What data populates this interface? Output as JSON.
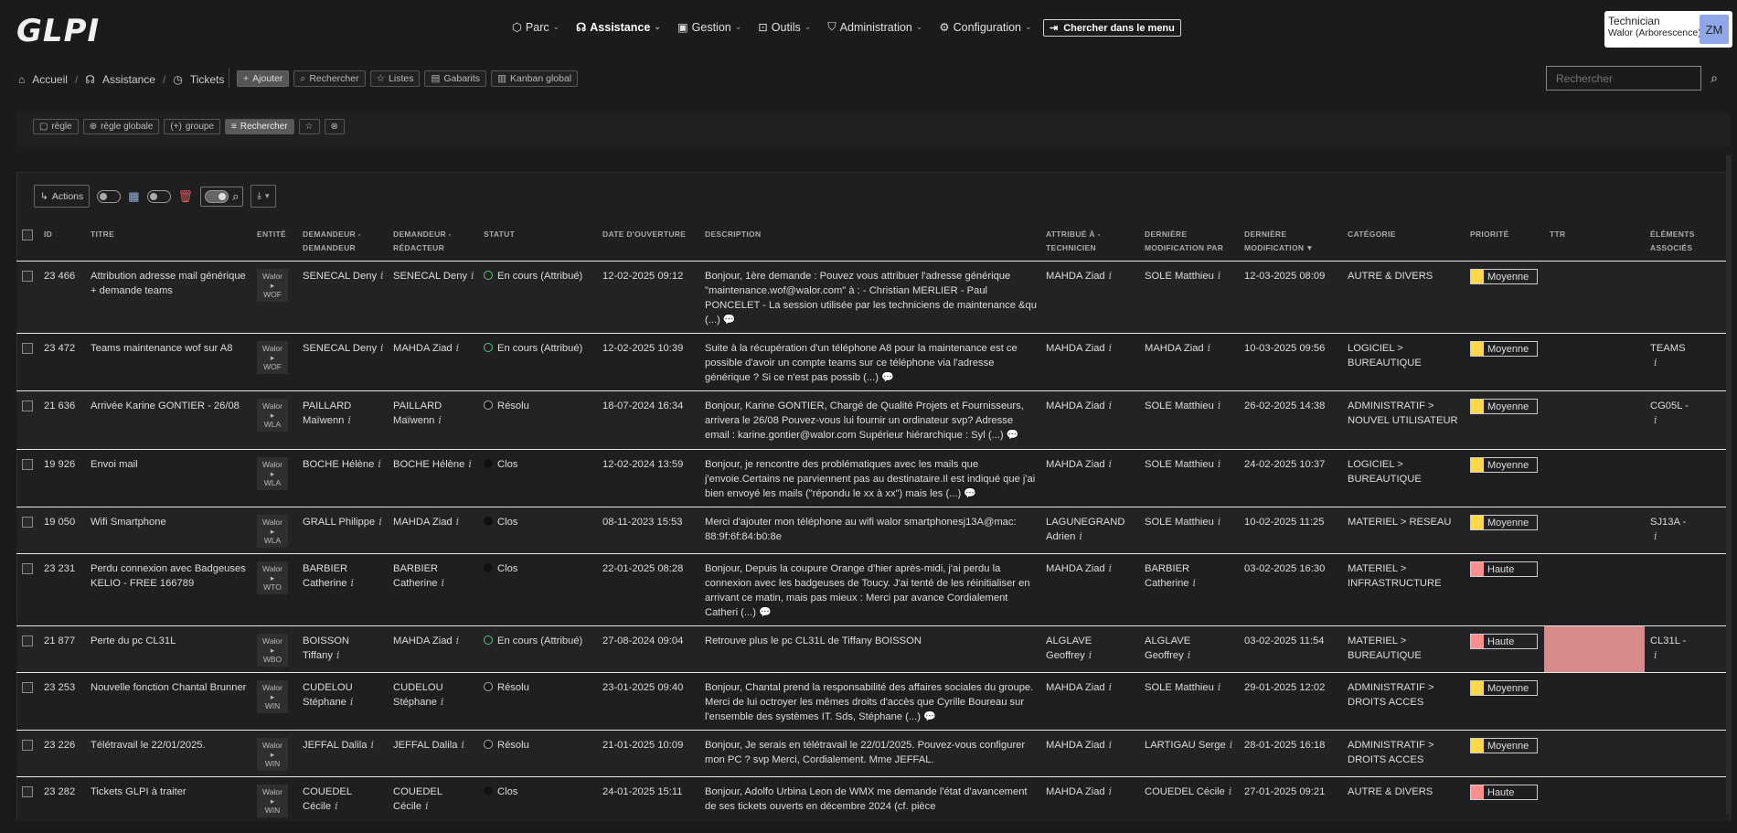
{
  "app": {
    "logo": "GLPI"
  },
  "menu": [
    {
      "icon": "box-icon",
      "glyph": "⬡",
      "label": "Parc"
    },
    {
      "icon": "headset-icon",
      "glyph": "☊",
      "label": "Assistance"
    },
    {
      "icon": "wallet-icon",
      "glyph": "▣",
      "label": "Gestion"
    },
    {
      "icon": "briefcase-icon",
      "glyph": "⊡",
      "label": "Outils"
    },
    {
      "icon": "shield-icon",
      "glyph": "⛉",
      "label": "Administration"
    },
    {
      "icon": "gear-icon",
      "glyph": "⚙",
      "label": "Configuration"
    }
  ],
  "menu_search": "Chercher dans le menu",
  "user": {
    "role": "Technician",
    "entity": "Walor (Arborescence)",
    "initials": "ZM"
  },
  "breadcrumb": [
    "Accueil",
    "Assistance",
    "Tickets"
  ],
  "actions": [
    "Ajouter",
    "Rechercher",
    "Listes",
    "Gabarits",
    "Kanban global"
  ],
  "search": {
    "placeholder": "Rechercher"
  },
  "criteria_buttons": [
    "règle",
    "règle globale",
    "groupe",
    "Rechercher"
  ],
  "toolbar": {
    "actions_label": "Actions"
  },
  "columns": [
    "",
    "ID",
    "TITRE",
    "ENTITÉ",
    "DEMANDEUR - DEMANDEUR",
    "DEMANDEUR - RÉDACTEUR",
    "STATUT",
    "DATE D'OUVERTURE",
    "DESCRIPTION",
    "ATTRIBUÉ À - TECHNICIEN",
    "DERNIÈRE MODIFICATION PAR",
    "DERNIÈRE MODIFICATION",
    "CATÉGORIE",
    "PRIORITÉ",
    "TTR",
    "ÉLÉMENTS ASSOCIÉS"
  ],
  "sort_indicator": "▼",
  "rows": [
    {
      "id": "23 466",
      "title": "Attribution adresse mail générique + demande teams",
      "entity_top": "Walor",
      "entity_bottom": "WOF",
      "requester": "SENECAL Deny",
      "writer": "SENECAL Deny",
      "status": "En cours (Attribué)",
      "status_kind": "cours",
      "opened": "12-02-2025 09:12",
      "description": "Bonjour, 1ère demande : Pouvez vous attribuer l'adresse générique \"maintenance.wof@walor.com\" à : - Christian MERLIER - Paul PONCELET - La session utilisée par les techniciens de maintenance &qu (...)",
      "tech": "MAHDA Ziad",
      "modified_by": "SOLE Matthieu",
      "modified": "12-03-2025 08:09",
      "category": "AUTRE & DIVERS",
      "priority": "Moyenne",
      "priority_kind": "moy",
      "ttr": "",
      "items": ""
    },
    {
      "id": "23 472",
      "title": "Teams maintenance wof sur A8",
      "entity_top": "Walor",
      "entity_bottom": "WOF",
      "requester": "SENECAL Deny",
      "writer": "MAHDA Ziad",
      "status": "En cours (Attribué)",
      "status_kind": "cours",
      "opened": "12-02-2025 10:39",
      "description": "Suite à la récupération d'un téléphone A8 pour la maintenance est ce possible d'avoir un compte teams sur ce téléphone via l'adresse générique ? Si ce n'est pas possib (...)",
      "tech": "MAHDA Ziad",
      "modified_by": "MAHDA Ziad",
      "modified": "10-03-2025 09:56",
      "category": "LOGICIEL > BUREAUTIQUE",
      "priority": "Moyenne",
      "priority_kind": "moy",
      "ttr": "",
      "items": "TEAMS"
    },
    {
      "id": "21 636",
      "title": "Arrivée Karine GONTIER - 26/08",
      "entity_top": "Walor",
      "entity_bottom": "WLA",
      "requester": "PAILLARD Maïwenn",
      "writer": "PAILLARD Maïwenn",
      "status": "Résolu",
      "status_kind": "resolu",
      "opened": "18-07-2024 16:34",
      "description": "Bonjour, Karine GONTIER, Chargé de Qualité Projets et Fournisseurs, arrivera le 26/08 Pouvez-vous lui fournir un ordinateur svp? Adresse email : karine.gontier@walor.com Supérieur hiérarchique : Syl (...)",
      "tech": "MAHDA Ziad",
      "modified_by": "SOLE Matthieu",
      "modified": "26-02-2025 14:38",
      "category": "ADMINISTRATIF > NOUVEL UTILISATEUR",
      "priority": "Moyenne",
      "priority_kind": "moy",
      "ttr": "",
      "items": "CG05L -"
    },
    {
      "id": "19 926",
      "title": "Envoi mail",
      "entity_top": "Walor",
      "entity_bottom": "WLA",
      "requester": "BOCHE Hélène",
      "writer": "BOCHE Hélène",
      "status": "Clos",
      "status_kind": "clos",
      "opened": "12-02-2024 13:59",
      "description": "Bonjour, je rencontre des problématiques avec les mails que j'envoie.Certains ne parviennent pas au destinataire.Il est indiqué que j'ai bien envoyé les mails (\"répondu le xx à xx\") mais les (...)",
      "tech": "MAHDA Ziad",
      "modified_by": "SOLE Matthieu",
      "modified": "24-02-2025 10:37",
      "category": "LOGICIEL > BUREAUTIQUE",
      "priority": "Moyenne",
      "priority_kind": "moy",
      "ttr": "",
      "items": ""
    },
    {
      "id": "19 050",
      "title": "Wifi Smartphone",
      "entity_top": "Walor",
      "entity_bottom": "WLA",
      "requester": "GRALL Philippe",
      "writer": "MAHDA Ziad",
      "status": "Clos",
      "status_kind": "clos",
      "opened": "08-11-2023 15:53",
      "description": "Merci d'ajouter mon téléphone au wifi walor smartphonesj13A@mac: 88:9f:6f:84:b0:8e",
      "tech": "LAGUNEGRAND Adrien",
      "modified_by": "SOLE Matthieu",
      "modified": "10-02-2025 11:25",
      "category": "MATERIEL > RESEAU",
      "priority": "Moyenne",
      "priority_kind": "moy",
      "ttr": "",
      "items": "SJ13A -"
    },
    {
      "id": "23 231",
      "title": "Perdu connexion avec Badgeuses KELIO - FREE 166789",
      "entity_top": "Walor",
      "entity_bottom": "WTO",
      "requester": "BARBIER Catherine",
      "writer": "BARBIER Catherine",
      "status": "Clos",
      "status_kind": "clos",
      "opened": "22-01-2025 08:28",
      "description": "Bonjour, Depuis la coupure Orange d'hier après-midi, j'ai perdu la connexion avec les badgeuses de Toucy. J'ai tenté de les réinitialiser en arrivant ce matin, mais pas mieux : Merci par avance Cordialement Catheri (...)",
      "tech": "MAHDA Ziad",
      "modified_by": "BARBIER Catherine",
      "modified": "03-02-2025 16:30",
      "category": "MATERIEL > INFRASTRUCTURE",
      "priority": "Haute",
      "priority_kind": "haute",
      "ttr": "",
      "items": ""
    },
    {
      "id": "21 877",
      "title": "Perte du pc CL31L",
      "entity_top": "Walor",
      "entity_bottom": "WBO",
      "requester": "BOISSON Tiffany",
      "writer": "MAHDA Ziad",
      "status": "En cours (Attribué)",
      "status_kind": "cours",
      "opened": "27-08-2024 09:04",
      "description": "Retrouve plus le pc CL31L de Tiffany BOISSON",
      "tech": "ALGLAVE Geoffrey",
      "modified_by": "ALGLAVE Geoffrey",
      "modified": "03-02-2025 11:54",
      "category": "MATERIEL > BUREAUTIQUE",
      "priority": "Haute",
      "priority_kind": "haute",
      "ttr": "",
      "ttr_overdue": true,
      "items": "CL31L -"
    },
    {
      "id": "23 253",
      "title": "Nouvelle fonction Chantal Brunner",
      "entity_top": "Walor",
      "entity_bottom": "WIN",
      "requester": "CUDELOU Stéphane",
      "writer": "CUDELOU Stéphane",
      "status": "Résolu",
      "status_kind": "resolu",
      "opened": "23-01-2025 09:40",
      "description": "Bonjour, Chantal prend la responsabilité des affaires sociales du groupe. Merci de lui octroyer les mêmes droits d'accès que Cyrille Boureau sur l'ensemble des systèmes IT. Sds, Stéphane (...)",
      "tech": "MAHDA Ziad",
      "modified_by": "SOLE Matthieu",
      "modified": "29-01-2025 12:02",
      "category": "ADMINISTRATIF > DROITS ACCES",
      "priority": "Moyenne",
      "priority_kind": "moy",
      "ttr": "",
      "items": ""
    },
    {
      "id": "23 226",
      "title": "Télétravail le 22/01/2025.",
      "entity_top": "Walor",
      "entity_bottom": "WIN",
      "requester": "JEFFAL Dalila",
      "writer": "JEFFAL Dalila",
      "status": "Résolu",
      "status_kind": "resolu",
      "opened": "21-01-2025 10:09",
      "description": "Bonjour, Je serais en télétravail le 22/01/2025. Pouvez-vous configurer mon PC ? svp Merci, Cordialement. Mme JEFFAL.",
      "tech": "MAHDA Ziad",
      "modified_by": "LARTIGAU Serge",
      "modified": "28-01-2025 16:18",
      "category": "ADMINISTRATIF > DROITS ACCES",
      "priority": "Moyenne",
      "priority_kind": "moy",
      "ttr": "",
      "items": ""
    },
    {
      "id": "23 282",
      "title": "Tickets GLPI à traiter",
      "entity_top": "Walor",
      "entity_bottom": "WIN",
      "requester": "COUEDEL Cécile",
      "writer": "COUEDEL Cécile",
      "status": "Clos",
      "status_kind": "clos",
      "opened": "24-01-2025 15:11",
      "description": "Bonjour, Adolfo Urbina Leon de WMX me demande l'état d'avancement de ses tickets ouverts en décembre 2024 (cf. pièce",
      "tech": "MAHDA Ziad",
      "modified_by": "COUEDEL Cécile",
      "modified": "27-01-2025 09:21",
      "category": "AUTRE & DIVERS",
      "priority": "Haute",
      "priority_kind": "haute",
      "ttr": "",
      "items": ""
    }
  ]
}
